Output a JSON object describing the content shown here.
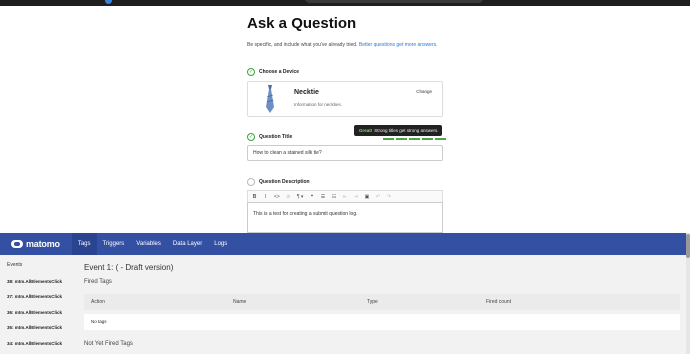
{
  "question_page": {
    "title": "Ask a Question",
    "intro_text": "Be specific, and include what you've already tried.",
    "intro_link": "Better questions get more answers.",
    "steps": {
      "device": "Choose a Device",
      "title": "Question Title",
      "description": "Question Description"
    },
    "device": {
      "name": "Necktie",
      "info": "Information for neckties.",
      "change_label": "Change"
    },
    "tooltip": {
      "strong": "Great!",
      "text": "Strong titles get strong answers."
    },
    "title_value": "How to clean a stained silk tie?",
    "description_value": "This is a test for creating a submit question log.",
    "editor_toolbar": {
      "bold": "B",
      "italic": "I",
      "code": "<>",
      "link": "⊘",
      "paragraph": "¶ ▾",
      "quote": "❝",
      "bullet_list": "☰",
      "numbered_list": "☷",
      "outdent": "⇤",
      "indent": "⇥",
      "image": "▣",
      "undo": "↶",
      "redo": "↷"
    }
  },
  "matomo": {
    "logo_text": "matomo",
    "nav": [
      "Tags",
      "Triggers",
      "Variables",
      "Data Layer",
      "Logs"
    ],
    "active_tab": "Tags",
    "sidebar": {
      "title": "Events",
      "items": [
        "38: mtm.AllElementsClick",
        "37: mtm.AllElementsClick",
        "36: mtm.AllElementsClick",
        "35: mtm.AllElementsClick",
        "34: mtm.AllElementsClick"
      ]
    },
    "event_title": "Event 1: ( - Draft version)",
    "fired_tags_heading": "Fired Tags",
    "table_headers": {
      "action": "Action",
      "name": "Name",
      "type": "Type",
      "fired_count": "Fired count"
    },
    "empty_row": "No tags",
    "not_fired_heading": "Not Yet Fired Tags"
  },
  "colors": {
    "matomo_blue": "#3450a3",
    "check_green": "#3aa33a",
    "link_blue": "#2a7ad5"
  }
}
